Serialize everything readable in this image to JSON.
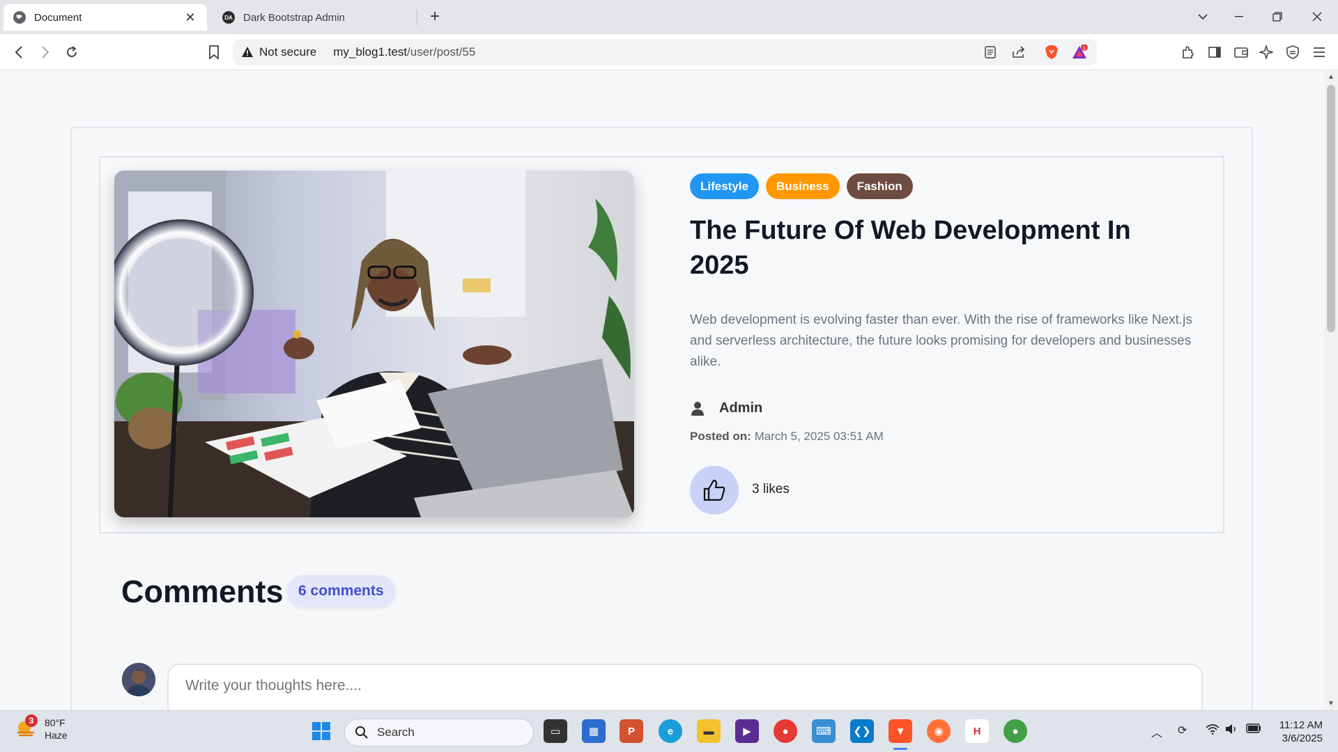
{
  "browser": {
    "tabs": [
      {
        "title": "Document",
        "active": true
      },
      {
        "title": "Dark Bootstrap Admin",
        "favicon_text": "DA",
        "active": false
      }
    ],
    "security_label": "Not secure",
    "url_host": "my_blog1.test",
    "url_path": "/user/post/55",
    "notification_count": "1"
  },
  "post": {
    "tags": [
      "Lifestyle",
      "Business",
      "Fashion"
    ],
    "tag_colors": [
      "#2196f3",
      "#ff9800",
      "#6d4c41"
    ],
    "title": "The Future Of Web Development In 2025",
    "excerpt": "Web development is evolving faster than ever. With the rise of frameworks like Next.js and serverless architecture, the future looks promising for developers and businesses alike.",
    "author": "Admin",
    "posted_on_label": "Posted on:",
    "posted_on_value": "March 5, 2025 03:51 AM",
    "likes_text": "3 likes"
  },
  "comments": {
    "title": "Comments",
    "count_badge": "6 comments",
    "input_placeholder": "Write your thoughts here...."
  },
  "taskbar": {
    "weather_temp": "80°F",
    "weather_desc": "Haze",
    "weather_badge": "3",
    "search_label": "Search",
    "time": "11:12 AM",
    "date": "3/6/2025"
  }
}
